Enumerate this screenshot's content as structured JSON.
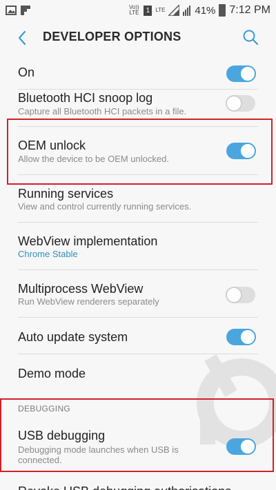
{
  "status_bar": {
    "lte_volte": "Vo))\nLTE",
    "sim": "1",
    "lte_label": "LTE",
    "battery_percent": "41%",
    "time": "7:12 PM"
  },
  "app_bar": {
    "title": "DEVELOPER OPTIONS"
  },
  "master_toggle": {
    "label": "On",
    "state": true
  },
  "items": [
    {
      "title": "Bluetooth HCI snoop log",
      "subtitle": "Capture all Bluetooth HCI packets in a file.",
      "toggle": false
    },
    {
      "title": "OEM unlock",
      "subtitle": "Allow the device to be OEM unlocked.",
      "toggle": true
    },
    {
      "title": "Running services",
      "subtitle": "View and control currently running services."
    },
    {
      "title": "WebView implementation",
      "subtitle": "Chrome Stable"
    },
    {
      "title": "Multiprocess WebView",
      "subtitle": "Run WebView renderers separately",
      "toggle": false
    },
    {
      "title": "Auto update system",
      "toggle": true
    },
    {
      "title": "Demo mode"
    },
    {
      "title": "USB debugging",
      "subtitle_line1": "Debugging mode launches when USB is",
      "subtitle_line2": "connected.",
      "toggle": true
    },
    {
      "title": "Revoke USB debugging authorisations"
    }
  ],
  "sections": {
    "debugging": "DEBUGGING"
  },
  "colors": {
    "accent": "#4ba6df",
    "highlight": "#d32027",
    "link": "#2f8fc5"
  }
}
